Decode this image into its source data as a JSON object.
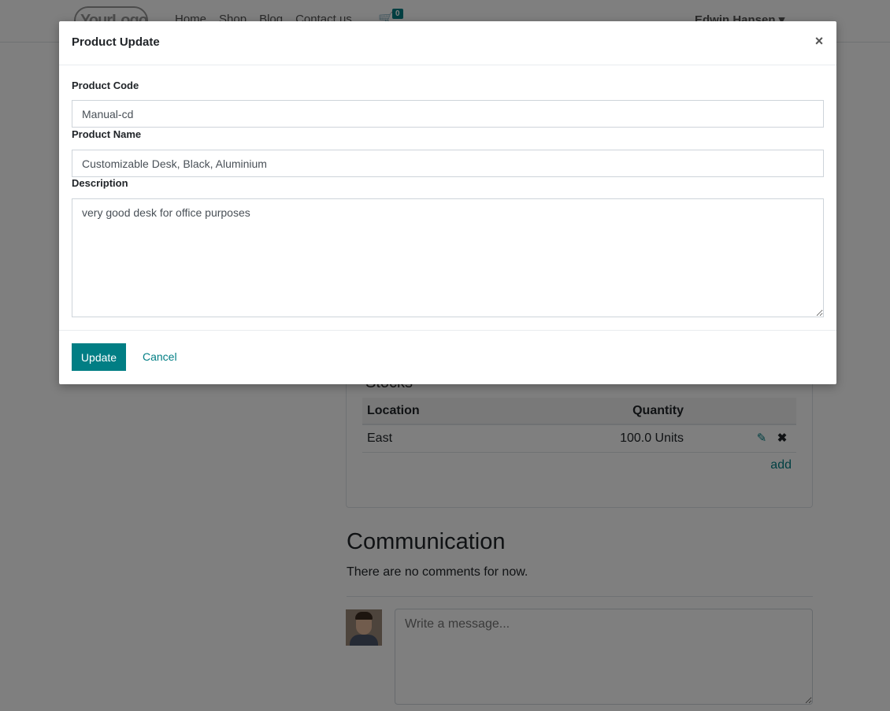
{
  "navbar": {
    "logo_text": "YourLogo",
    "links": [
      "Home",
      "Shop",
      "Blog",
      "Contact us"
    ],
    "cart_count": "0",
    "user_name": "Edwin Hansen"
  },
  "stock": {
    "heading": "Stocks",
    "columns": {
      "location": "Location",
      "quantity": "Quantity"
    },
    "rows": [
      {
        "location": "East",
        "quantity": "100.0 Units"
      }
    ],
    "add_label": "add"
  },
  "communication": {
    "title": "Communication",
    "empty_text": "There are no comments for now.",
    "message_placeholder": "Write a message..."
  },
  "modal": {
    "title": "Product Update",
    "close_glyph": "×",
    "product_code_label": "Product Code",
    "product_code_value": "Manual-cd",
    "product_name_label": "Product Name",
    "product_name_value": "Customizable Desk, Black, Aluminium",
    "description_label": "Description",
    "description_value": "very good desk for office purposes",
    "update_label": "Update",
    "cancel_label": "Cancel"
  },
  "colors": {
    "accent": "#017e84",
    "backdrop": "rgba(0,0,0,0.5)"
  }
}
